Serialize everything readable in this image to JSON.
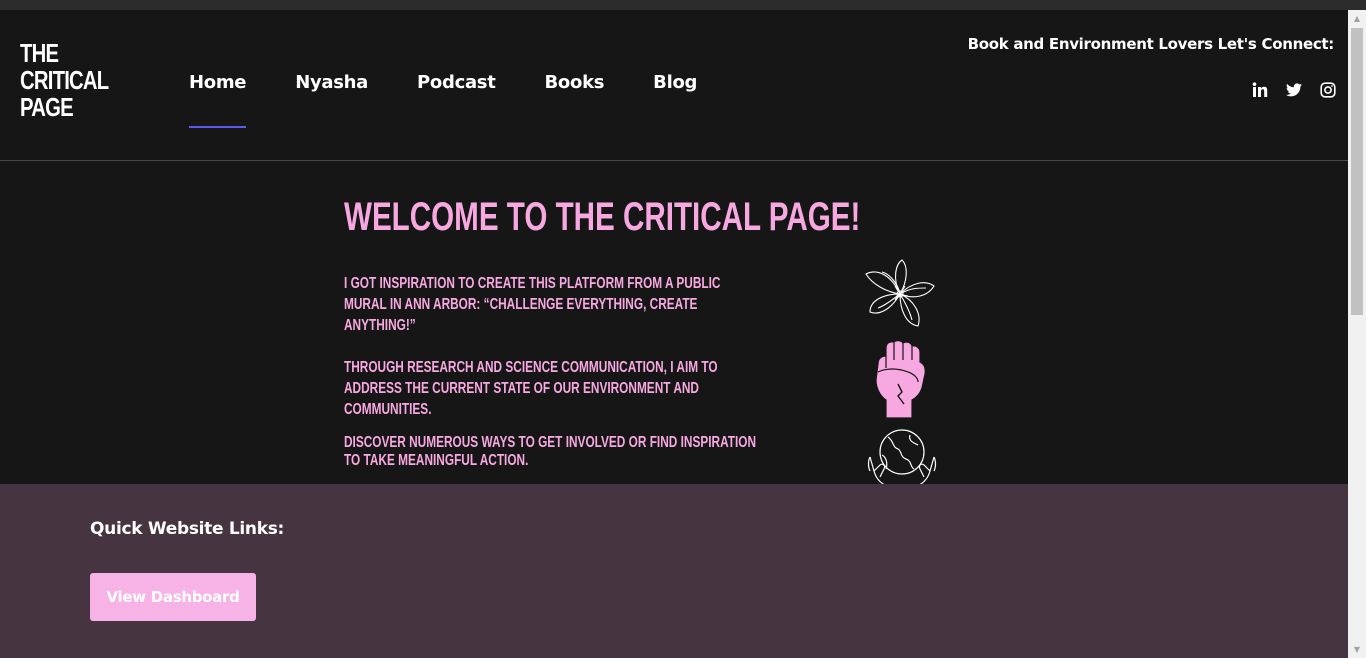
{
  "logo": {
    "lines": [
      "THE",
      "CRITICAL",
      "PAGE"
    ]
  },
  "nav": [
    {
      "label": "Home",
      "active": true
    },
    {
      "label": "Nyasha",
      "active": false
    },
    {
      "label": "Podcast",
      "active": false
    },
    {
      "label": "Books",
      "active": false
    },
    {
      "label": "Blog",
      "active": false
    }
  ],
  "header": {
    "connect_text": "Book and Environment Lovers Let's Connect:",
    "socials": [
      "linkedin-icon",
      "twitter-icon",
      "instagram-icon"
    ]
  },
  "main": {
    "title": "WELCOME TO THE CRITICAL PAGE!",
    "paragraphs": [
      "I GOT INSPIRATION TO CREATE THIS PLATFORM FROM A PUBLIC MURAL IN ANN ARBOR: “CHALLENGE EVERYTHING, CREATE ANYTHING!”",
      "THROUGH RESEARCH AND SCIENCE COMMUNICATION, I AIM TO ADDRESS THE CURRENT STATE OF OUR ENVIRONMENT AND COMMUNITIES.",
      "DISCOVER NUMEROUS WAYS TO GET INVOLVED OR FIND INSPIRATION TO TAKE MEANINGFUL ACTION."
    ],
    "icons": [
      "flower-icon",
      "raised-fist-icon",
      "hands-globe-icon"
    ]
  },
  "quick_links": {
    "title": "Quick Website Links:",
    "button_label": "View Dashboard"
  },
  "colors": {
    "background": "#161616",
    "accent_pink": "#f7a8e0",
    "nav_underline": "#5b5bf0",
    "footer_bg": "#463441"
  }
}
